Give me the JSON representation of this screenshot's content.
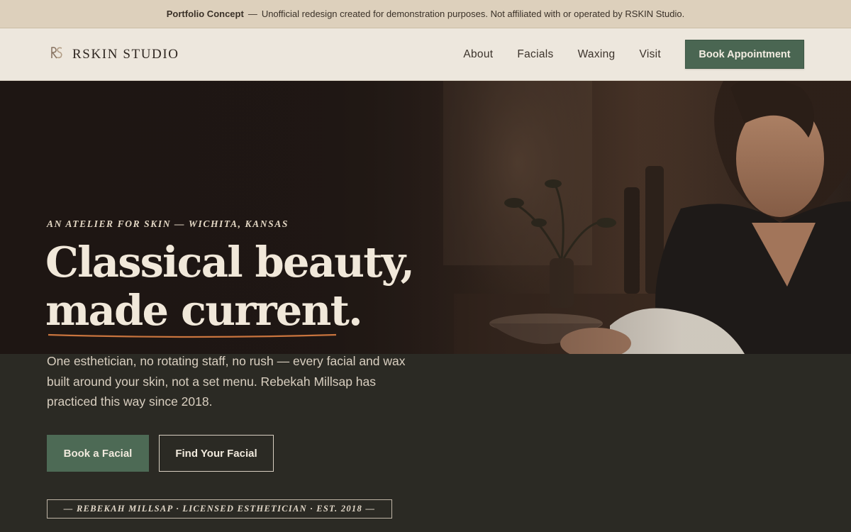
{
  "notice": {
    "label": "Portfolio Concept",
    "separator": "—",
    "text": "Unofficial redesign created for demonstration purposes. Not affiliated with or operated by RSKIN Studio."
  },
  "header": {
    "brand_name": "RSKIN STUDIO",
    "brand_icon": "rs-monogram-icon",
    "nav": [
      "About",
      "Facials",
      "Waxing",
      "Visit"
    ],
    "book_label": "Book Appointment"
  },
  "hero": {
    "eyebrow": "AN ATELIER FOR SKIN — WICHITA, KANSAS",
    "headline_line1": "Classical beauty,",
    "headline_line2": "made current.",
    "lede": "One esthetician, no rotating staff, no rush — every facial and wax built around your skin, not a set menu. Rebekah Millsap has practiced this way since 2018.",
    "cta_primary": "Book a Facial",
    "cta_secondary": "Find Your Facial",
    "credential": "— REBEKAH MILLSAP · LICENSED ESTHETICIAN · EST. 2018 —"
  },
  "colors": {
    "accent_green": "#4a6652",
    "underline_copper": "#c9743e",
    "notice_bg": "#ddd0bc",
    "header_bg": "#ede7dd"
  }
}
